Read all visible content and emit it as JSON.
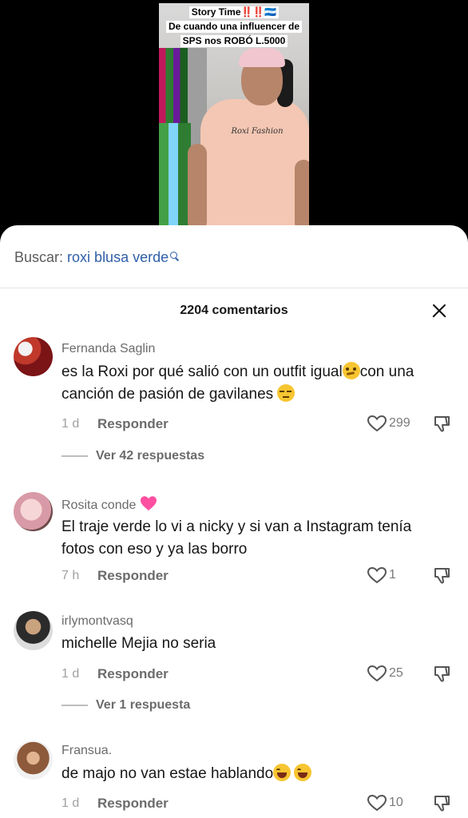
{
  "video": {
    "caption_line1": "Story Time‼️‼️🇭🇳",
    "caption_line2": "De cuando una influencer de",
    "caption_line3": "SPS nos ROBÓ L.5000",
    "shirt_text": "Roxi Fashion"
  },
  "search": {
    "label": "Buscar:",
    "query": "roxi blusa verde"
  },
  "comments_count": "2204 comentarios",
  "comments": [
    {
      "name": "Fernanda Saglin",
      "text_part1": "es la Roxi por qué salió con un outfit igual",
      "text_part2": "con una canción de pasión de gavilanes ",
      "time": "1 d",
      "reply_label": "Responder",
      "likes": "299",
      "view_replies": "Ver 42 respuestas",
      "avatar_color": "#b3262b"
    },
    {
      "name": "Rosita conde",
      "text": "El traje verde lo vi a nicky y si van a Instagram tenía fotos con eso y ya las borro",
      "time": "7 h",
      "reply_label": "Responder",
      "likes": "1",
      "avatar_color": "#e8b7c0"
    },
    {
      "name": "irlymontvasq",
      "text": "michelle Mejia no seria",
      "time": "1 d",
      "reply_label": "Responder",
      "likes": "25",
      "view_replies": "Ver 1 respuesta",
      "avatar_color": "#3a3a3a"
    },
    {
      "name": "Fransua.",
      "text": "de majo no van estae hablando",
      "time": "1 d",
      "reply_label": "Responder",
      "likes": "10",
      "avatar_color": "#8d5a3b"
    }
  ]
}
